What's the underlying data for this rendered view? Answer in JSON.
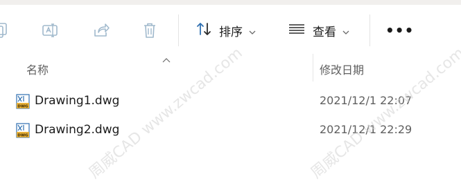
{
  "toolbar": {
    "sort_label": "排序",
    "view_label": "查看",
    "more_label": "•••"
  },
  "columns": {
    "name": "名称",
    "date_modified": "修改日期"
  },
  "files": [
    {
      "name": "Drawing1.dwg",
      "modified": "2021/12/1 22:07",
      "icon": "dwg-file-icon",
      "badge": "DWG"
    },
    {
      "name": "Drawing2.dwg",
      "modified": "2021/12/1 22:29",
      "icon": "dwg-file-icon",
      "badge": "DWG"
    }
  ],
  "watermark": {
    "text": "周威CAD www.zwcad.com",
    "watermark_left": "周威CAD",
    "watermark_right": "周威CAD www.zwcad.com"
  },
  "colors": {
    "toolbar_icon_disabled": "#9fb8cc",
    "accent_blue": "#2f6fb0",
    "dwg_badge": "#e8b13a"
  }
}
